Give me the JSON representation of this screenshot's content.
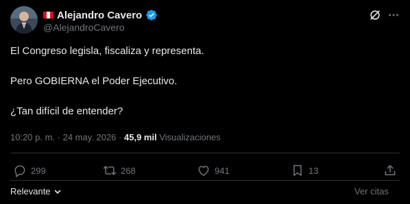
{
  "author": {
    "display_name": "Alejandro Cavero",
    "handle": "@AlejandroCavero",
    "flag_colors": [
      "#d91023",
      "#ffffff",
      "#d91023"
    ],
    "verified_color": "#1d9bf0",
    "verified_icon": "verified-badge-icon",
    "avatar_icon": "avatar-photo"
  },
  "tweet": {
    "paragraphs": [
      "El Congreso legisla, fiscaliza y representa.",
      "Pero GOBIERNA el Poder Ejecutivo.",
      "¿Tan difícil de entender?"
    ],
    "timestamp": "10:20 p. m. · 24 may. 2026",
    "separator": "·",
    "views_count": "45,9 mil",
    "views_label": "Visualizaciones"
  },
  "actions": {
    "replies": "299",
    "retweets": "268",
    "likes": "941",
    "bookmarks": "13"
  },
  "footer": {
    "sort_label": "Relevante",
    "quotes_label": "Ver citas"
  },
  "colors": {
    "background": "#000000",
    "text": "#e7e9ea",
    "muted": "#71767b",
    "divider": "#2f3336",
    "accent": "#1d9bf0"
  }
}
